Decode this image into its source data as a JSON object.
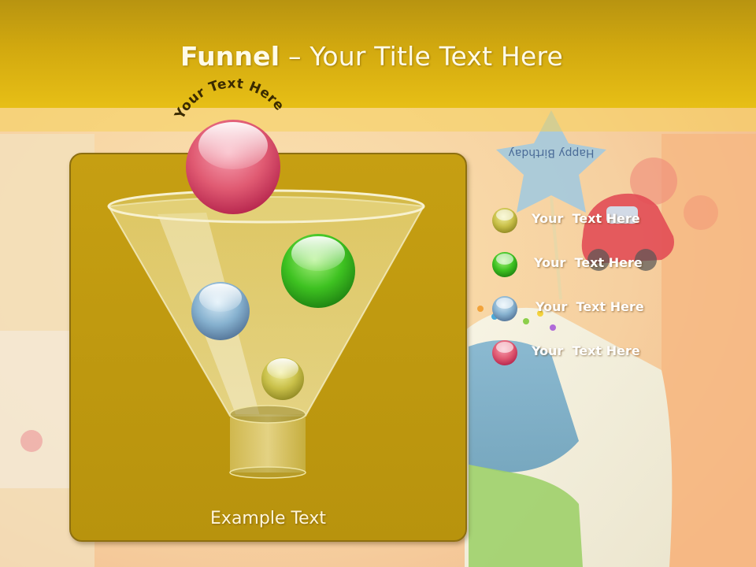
{
  "slide": {
    "title_bold": "Funnel",
    "title_rest": " – Your Title Text Here",
    "arc_label": "Your Text Here",
    "example_text": "Example Text",
    "background_sign": "Happy Birthday"
  },
  "legend": [
    {
      "label": "Your  Text Here",
      "color": "#bdb43e",
      "icon": "olive-ball-icon"
    },
    {
      "label": "Your  Text Here",
      "color": "#47b82a",
      "icon": "green-ball-icon"
    },
    {
      "label": "Your  Text Here",
      "color": "#7ea9c8",
      "icon": "blue-ball-icon"
    },
    {
      "label": "Your  Text Here",
      "color": "#d94f6a",
      "icon": "red-ball-icon"
    }
  ],
  "colors": {
    "header": "#d2a90f",
    "panel": "#c1990f",
    "red_ball": "#d94f6a",
    "green_ball": "#3cb624",
    "blue_ball": "#7da8c9",
    "olive_ball": "#c4bb45"
  }
}
